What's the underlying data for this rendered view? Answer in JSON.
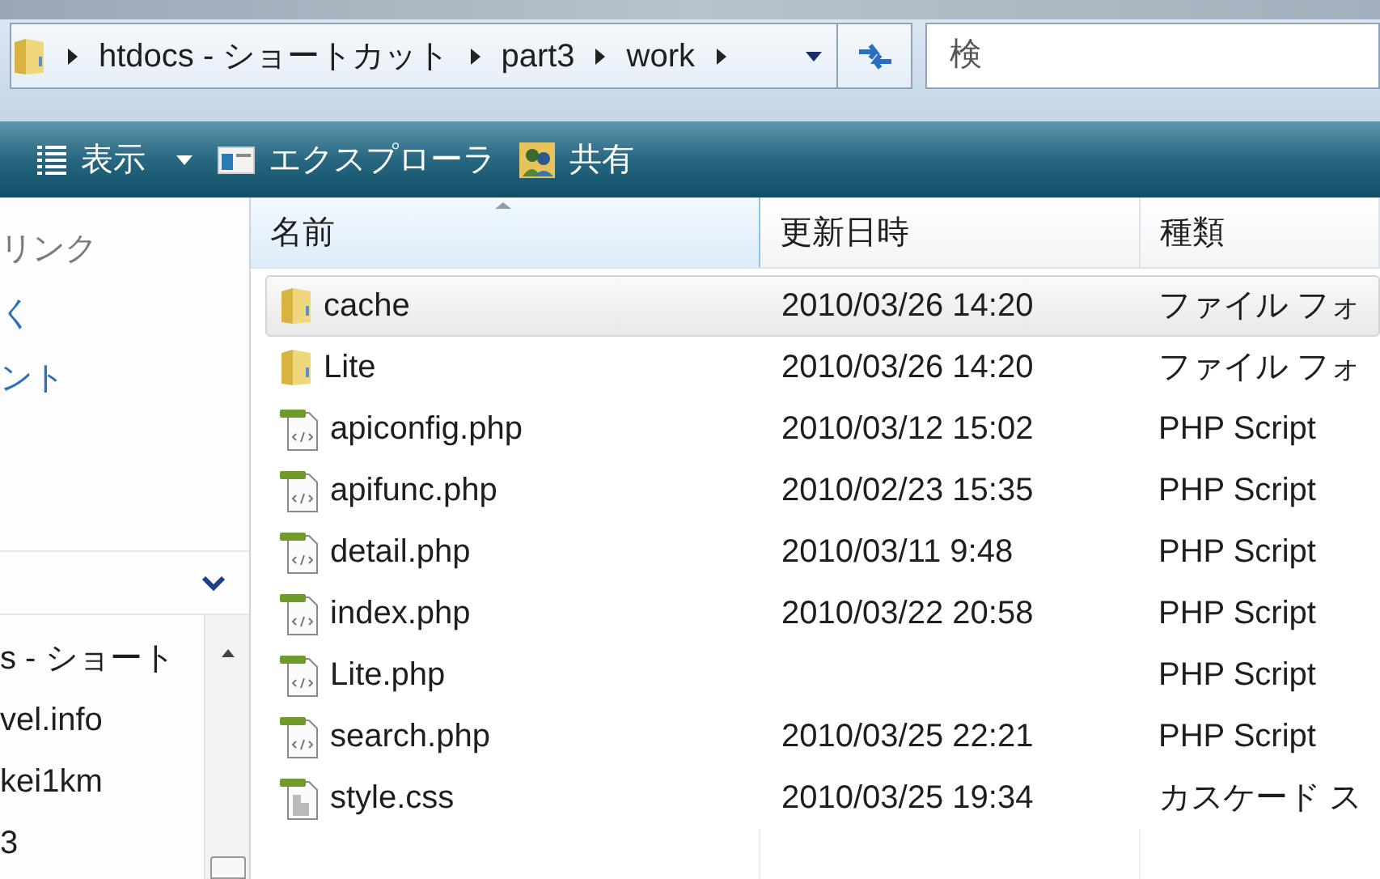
{
  "address_bar": {
    "crumbs": [
      "htdocs - ショートカット",
      "part3",
      "work"
    ]
  },
  "search": {
    "placeholder": "検"
  },
  "toolbar": {
    "items": [
      {
        "label": "表示",
        "kind": "views"
      },
      {
        "label": "エクスプローラ",
        "kind": "explorer"
      },
      {
        "label": "共有",
        "kind": "share"
      }
    ]
  },
  "nav_pane": {
    "links": [
      {
        "label": "リンク",
        "kind": "heading"
      },
      {
        "label": "く",
        "kind": "link"
      },
      {
        "label": "ント",
        "kind": "link"
      }
    ],
    "folders": [
      "s - ショート",
      "vel.info",
      "kei1km",
      "3"
    ]
  },
  "table": {
    "columns": [
      {
        "label": "名前",
        "sorted": true
      },
      {
        "label": "更新日時",
        "sorted": false
      },
      {
        "label": "種類",
        "sorted": false
      }
    ],
    "rows": [
      {
        "name": "cache",
        "modified": "2010/03/26 14:20",
        "type": "ファイル フォ",
        "kind": "folder",
        "selected": true
      },
      {
        "name": "Lite",
        "modified": "2010/03/26 14:20",
        "type": "ファイル フォ",
        "kind": "folder",
        "selected": false
      },
      {
        "name": "apiconfig.php",
        "modified": "2010/03/12 15:02",
        "type": "PHP Script",
        "kind": "php",
        "selected": false
      },
      {
        "name": "apifunc.php",
        "modified": "2010/02/23 15:35",
        "type": "PHP Script",
        "kind": "php",
        "selected": false
      },
      {
        "name": "detail.php",
        "modified": "2010/03/11 9:48",
        "type": "PHP Script",
        "kind": "php",
        "selected": false
      },
      {
        "name": "index.php",
        "modified": "2010/03/22 20:58",
        "type": "PHP Script",
        "kind": "php",
        "selected": false
      },
      {
        "name": "Lite.php",
        "type": "PHP Script",
        "kind": "php",
        "selected": false
      },
      {
        "name": "search.php",
        "modified": "2010/03/25 22:21",
        "type": "PHP Script",
        "kind": "php",
        "selected": false
      },
      {
        "name": "style.css",
        "modified": "2010/03/25 19:34",
        "type": "カスケード ス",
        "kind": "css",
        "selected": false
      }
    ]
  }
}
